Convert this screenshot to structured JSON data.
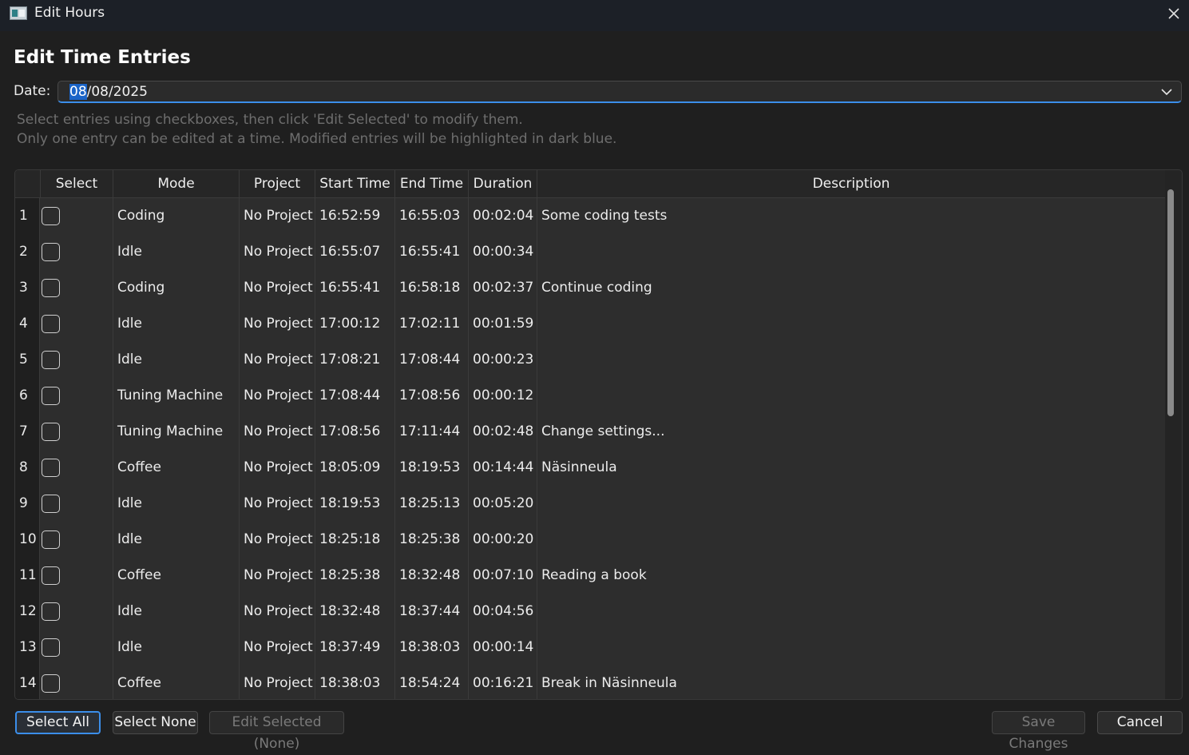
{
  "window": {
    "title": "Edit Hours"
  },
  "heading": "Edit Time Entries",
  "date": {
    "label": "Date:",
    "value_selected": "08",
    "value_rest": "/08/2025"
  },
  "hints": [
    "Select entries using checkboxes, then click 'Edit Selected' to modify them.",
    "Only one entry can be edited at a time. Modified entries will be highlighted in dark blue."
  ],
  "table": {
    "headers": [
      "Select",
      "Mode",
      "Project",
      "Start Time",
      "End Time",
      "Duration",
      "Description"
    ],
    "rows": [
      {
        "num": "1",
        "mode": "Coding",
        "project": "No Project",
        "start": "16:52:59",
        "end": "16:55:03",
        "duration": "00:02:04",
        "description": "Some coding tests"
      },
      {
        "num": "2",
        "mode": "Idle",
        "project": "No Project",
        "start": "16:55:07",
        "end": "16:55:41",
        "duration": "00:00:34",
        "description": ""
      },
      {
        "num": "3",
        "mode": "Coding",
        "project": "No Project",
        "start": "16:55:41",
        "end": "16:58:18",
        "duration": "00:02:37",
        "description": "Continue coding"
      },
      {
        "num": "4",
        "mode": "Idle",
        "project": "No Project",
        "start": "17:00:12",
        "end": "17:02:11",
        "duration": "00:01:59",
        "description": ""
      },
      {
        "num": "5",
        "mode": "Idle",
        "project": "No Project",
        "start": "17:08:21",
        "end": "17:08:44",
        "duration": "00:00:23",
        "description": ""
      },
      {
        "num": "6",
        "mode": "Tuning Machine",
        "project": "No Project",
        "start": "17:08:44",
        "end": "17:08:56",
        "duration": "00:00:12",
        "description": ""
      },
      {
        "num": "7",
        "mode": "Tuning Machine",
        "project": "No Project",
        "start": "17:08:56",
        "end": "17:11:44",
        "duration": "00:02:48",
        "description": "Change settings..."
      },
      {
        "num": "8",
        "mode": "Coffee",
        "project": "No Project",
        "start": "18:05:09",
        "end": "18:19:53",
        "duration": "00:14:44",
        "description": "Näsinneula"
      },
      {
        "num": "9",
        "mode": "Idle",
        "project": "No Project",
        "start": "18:19:53",
        "end": "18:25:13",
        "duration": "00:05:20",
        "description": ""
      },
      {
        "num": "10",
        "mode": "Idle",
        "project": "No Project",
        "start": "18:25:18",
        "end": "18:25:38",
        "duration": "00:00:20",
        "description": ""
      },
      {
        "num": "11",
        "mode": "Coffee",
        "project": "No Project",
        "start": "18:25:38",
        "end": "18:32:48",
        "duration": "00:07:10",
        "description": "Reading a book"
      },
      {
        "num": "12",
        "mode": "Idle",
        "project": "No Project",
        "start": "18:32:48",
        "end": "18:37:44",
        "duration": "00:04:56",
        "description": ""
      },
      {
        "num": "13",
        "mode": "Idle",
        "project": "No Project",
        "start": "18:37:49",
        "end": "18:38:03",
        "duration": "00:00:14",
        "description": ""
      },
      {
        "num": "14",
        "mode": "Coffee",
        "project": "No Project",
        "start": "18:38:03",
        "end": "18:54:24",
        "duration": "00:16:21",
        "description": "Break in Näsinneula"
      }
    ]
  },
  "buttons": {
    "select_all": "Select All",
    "select_none": "Select None",
    "edit_selected": "Edit Selected (None)",
    "save_changes": "Save Changes",
    "cancel": "Cancel"
  },
  "colors": {
    "accent": "#3b8eea",
    "selection": "#1a64c8"
  }
}
